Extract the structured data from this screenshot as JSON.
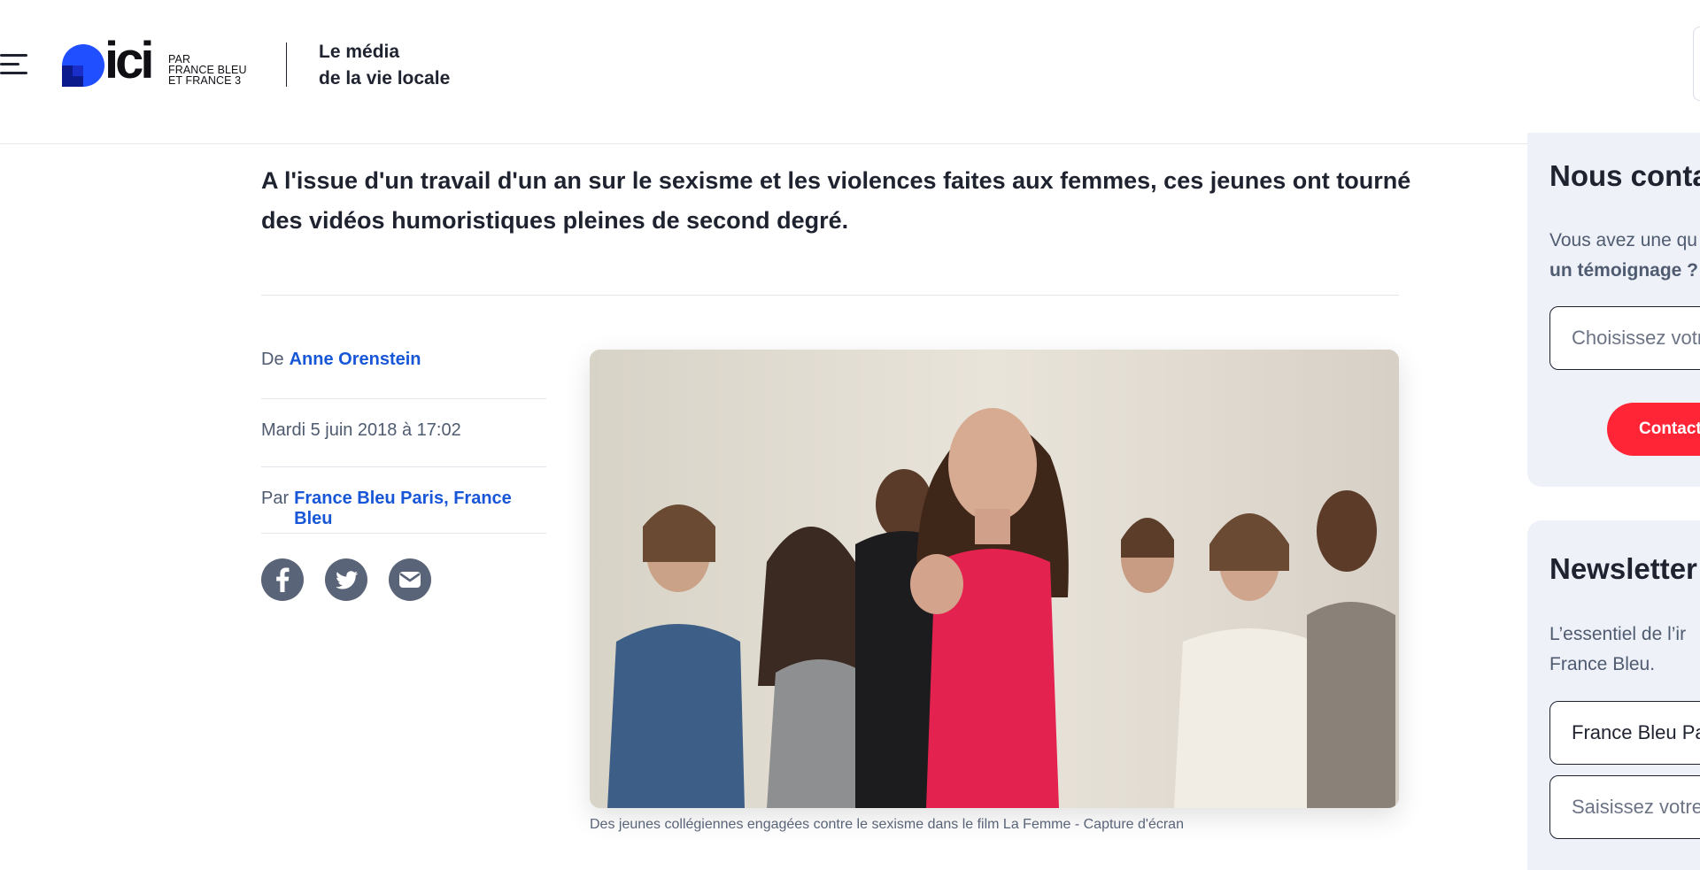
{
  "header": {
    "logo": {
      "wordmark": "ici",
      "subline": "PAR FRANCE BLEU ET FRANCE 3",
      "subline_lines": [
        "PAR",
        "FRANCE BLEU",
        "ET FRANCE 3"
      ]
    },
    "tagline_lines": [
      "Le média",
      "de la vie locale"
    ],
    "menu_icon": "hamburger-menu-icon"
  },
  "article": {
    "lead": "A l'issue d'un travail d'un an sur le sexisme et les violences faites aux femmes, ces jeunes ont tourné des vidéos humoristiques pleines de second degré.",
    "byline_label": "De",
    "author": "Anne Orenstein",
    "date": "Mardi 5 juin 2018 à 17:02",
    "source_label": "Par",
    "source": "France Bleu Paris, France Bleu",
    "share_icons": [
      "facebook-icon",
      "twitter-icon",
      "email-icon"
    ],
    "image_caption": "Des jeunes collégiennes engagées contre le sexisme dans le film La Femme - Capture d'écran"
  },
  "sidebar": {
    "contact": {
      "title": "Nous conta",
      "text_line1": "Vous avez une qu",
      "text_line2_bold": "un témoignage ?",
      "select_placeholder": "Choisissez votr",
      "button_label": "Contact"
    },
    "newsletter": {
      "title": "Newsletter",
      "text_line1": "L’essentiel de l’ir",
      "text_line2": "France Bleu.",
      "station_value": "France Bleu Pa",
      "email_placeholder": "Saisissez votre"
    }
  },
  "colors": {
    "link_blue": "#1856d8",
    "logo_blue": "#1f4fff",
    "accent_red": "#ff2436",
    "share_gray": "#5a6478",
    "sidebar_bg": "#eef1f8"
  }
}
